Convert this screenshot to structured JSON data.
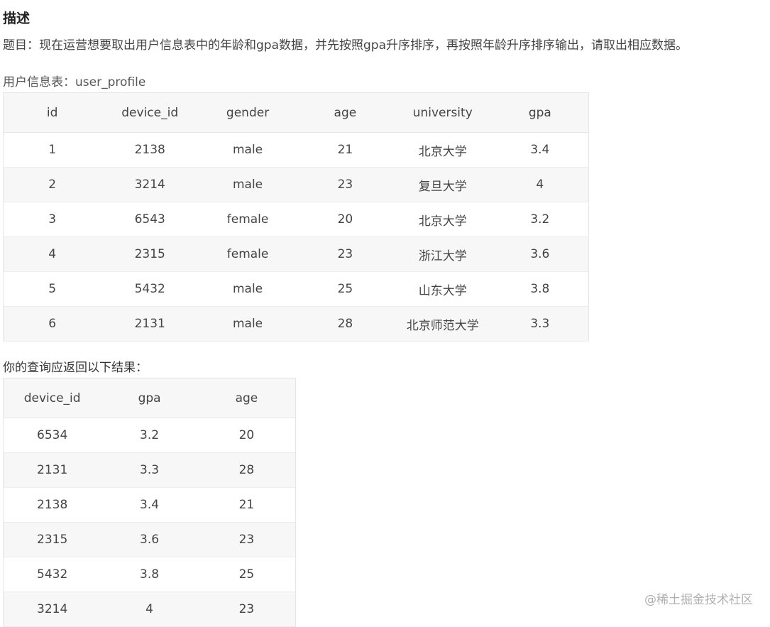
{
  "heading": "描述",
  "description": "题目：现在运营想要取出用户信息表中的年龄和gpa数据，并先按照gpa升序排序，再按照年龄升序排序输出，请取出相应数据。",
  "table1": {
    "caption": "用户信息表：user_profile",
    "columns": [
      "id",
      "device_id",
      "gender",
      "age",
      "university",
      "gpa"
    ],
    "rows": [
      [
        "1",
        "2138",
        "male",
        "21",
        "北京大学",
        "3.4"
      ],
      [
        "2",
        "3214",
        "male",
        "23",
        "复旦大学",
        "4"
      ],
      [
        "3",
        "6543",
        "female",
        "20",
        "北京大学",
        "3.2"
      ],
      [
        "4",
        "2315",
        "female",
        "23",
        "浙江大学",
        "3.6"
      ],
      [
        "5",
        "5432",
        "male",
        "25",
        "山东大学",
        "3.8"
      ],
      [
        "6",
        "2131",
        "male",
        "28",
        "北京师范大学",
        "3.3"
      ]
    ]
  },
  "table2": {
    "caption": "你的查询应返回以下结果：",
    "columns": [
      "device_id",
      "gpa",
      "age"
    ],
    "rows": [
      [
        "6534",
        "3.2",
        "20"
      ],
      [
        "2131",
        "3.3",
        "28"
      ],
      [
        "2138",
        "3.4",
        "21"
      ],
      [
        "2315",
        "3.6",
        "23"
      ],
      [
        "5432",
        "3.8",
        "25"
      ],
      [
        "3214",
        "4",
        "23"
      ]
    ]
  },
  "watermark": "@稀土掘金技术社区"
}
